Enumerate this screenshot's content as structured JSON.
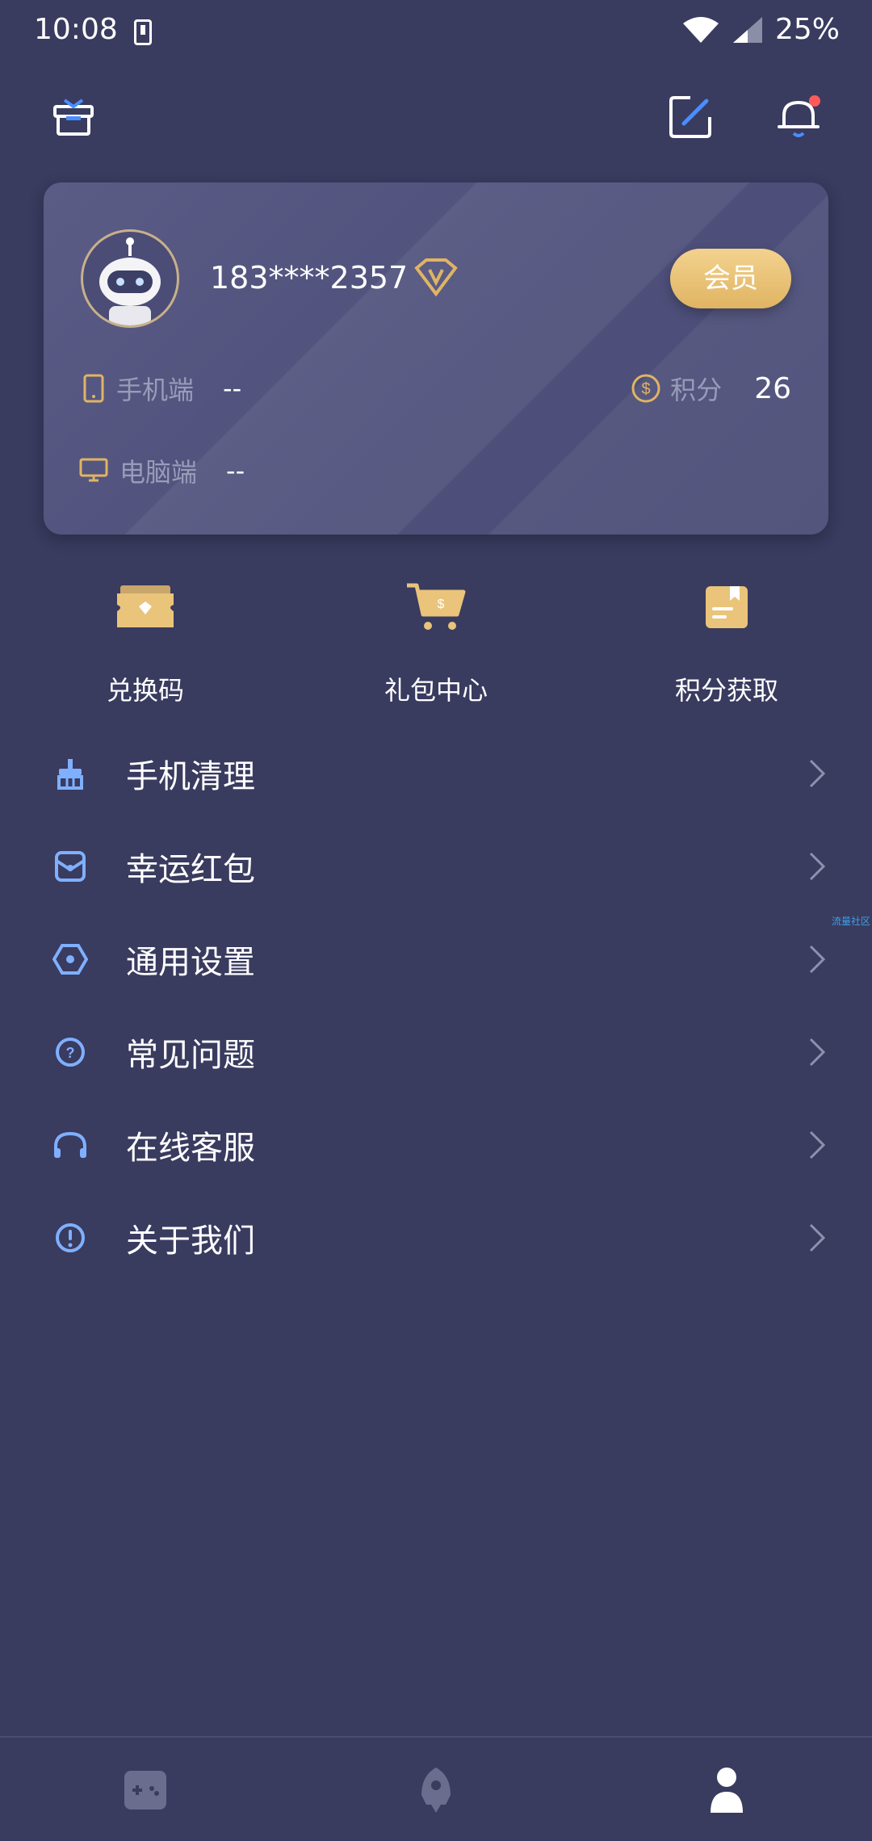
{
  "status_bar": {
    "time": "10:08",
    "battery": "25%"
  },
  "profile": {
    "username": "183****2357",
    "member_button": "会员",
    "mobile_label": "手机端",
    "mobile_value": "--",
    "pc_label": "电脑端",
    "pc_value": "--",
    "points_label": "积分",
    "points_value": "26"
  },
  "shortcuts": [
    {
      "label": "兑换码",
      "icon": "ticket-icon"
    },
    {
      "label": "礼包中心",
      "icon": "cart-icon"
    },
    {
      "label": "积分获取",
      "icon": "note-icon"
    }
  ],
  "menu": [
    {
      "label": "手机清理",
      "icon": "broom-icon"
    },
    {
      "label": "幸运红包",
      "icon": "red-packet-icon"
    },
    {
      "label": "通用设置",
      "icon": "settings-icon"
    },
    {
      "label": "常见问题",
      "icon": "question-icon"
    },
    {
      "label": "在线客服",
      "icon": "headset-icon"
    },
    {
      "label": "关于我们",
      "icon": "info-icon"
    }
  ],
  "watermark": "流量社区",
  "colors": {
    "background": "#393b5f",
    "card": "#55577f",
    "gold": "#e9c47a",
    "blue_icon": "#7fb0ff",
    "accent_red": "#ff5a5a"
  }
}
